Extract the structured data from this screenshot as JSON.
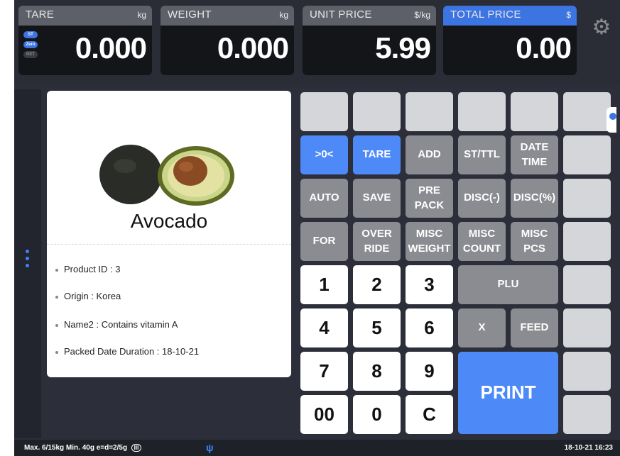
{
  "displays": {
    "tare": {
      "label": "TARE",
      "unit": "kg",
      "value": "0.000"
    },
    "weight": {
      "label": "WEIGHT",
      "unit": "kg",
      "value": "0.000"
    },
    "unit_price": {
      "label": "UNIT PRICE",
      "unit": "$/kg",
      "value": "5.99"
    },
    "total_price": {
      "label": "TOTAL PRICE",
      "unit": "$",
      "value": "0.00"
    }
  },
  "indicators": [
    "ST",
    "Zero",
    "NET"
  ],
  "product": {
    "name": "Avocado",
    "info": [
      "Product ID : 3",
      "Origin : Korea",
      "Name2 : Contains vitamin A",
      "Packed Date Duration : 18-10-21"
    ]
  },
  "keys": {
    "zero": ">0<",
    "tare": "TARE",
    "add": "ADD",
    "st_ttl": "ST/TTL",
    "date_time": "DATE\nTIME",
    "auto": "AUTO",
    "save": "SAVE",
    "pre_pack": "PRE\nPACK",
    "disc_minus": "DISC(-)",
    "disc_pct": "DISC(%)",
    "for": "FOR",
    "override": "OVER\nRIDE",
    "misc_weight": "MISC\nWEIGHT",
    "misc_count": "MISC\nCOUNT",
    "misc_pcs": "MISC\nPCS",
    "n1": "1",
    "n2": "2",
    "n3": "3",
    "n4": "4",
    "n5": "5",
    "n6": "6",
    "n7": "7",
    "n8": "8",
    "n9": "9",
    "n00": "00",
    "n0": "0",
    "clear": "C",
    "plu": "PLU",
    "x": "X",
    "feed": "FEED",
    "print": "PRINT"
  },
  "status": {
    "left": "Max. 6/15kg  Min. 40g  e=d=2/5g",
    "badge": "III",
    "datetime": "18-10-21 16:23"
  },
  "colors": {
    "accent": "#4d8af7",
    "key_dark": "#8a8c91",
    "key_blank": "#d4d6da"
  }
}
